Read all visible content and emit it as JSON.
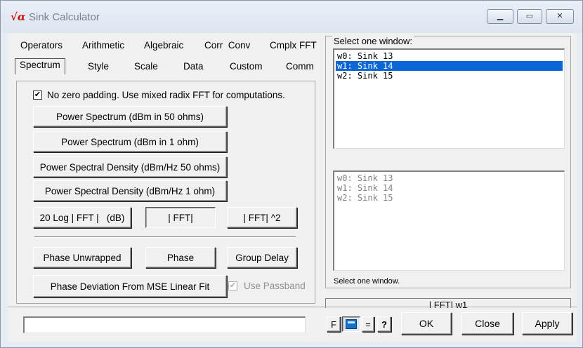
{
  "window": {
    "title": "Sink Calculator",
    "icon": "sqrt-alpha"
  },
  "tabs_row1": [
    {
      "label": "Operators"
    },
    {
      "label": "Arithmetic"
    },
    {
      "label": "Algebraic"
    },
    {
      "label": "Corr  Conv"
    },
    {
      "label": "Cmplx FFT"
    }
  ],
  "tabs_row2": [
    {
      "label": "Spectrum"
    },
    {
      "label": "Style"
    },
    {
      "label": "Scale"
    },
    {
      "label": "Data"
    },
    {
      "label": "Custom"
    },
    {
      "label": "Comm"
    }
  ],
  "spectrum": {
    "zero_padding_label": "No zero padding. Use mixed radix FFT for computations.",
    "zero_padding_checked": true,
    "buttons": {
      "ps50": "Power Spectrum (dBm in 50 ohms)",
      "ps1": "Power Spectrum (dBm in 1 ohm)",
      "psd50": "Power Spectral Density (dBm/Hz 50 ohms)",
      "psd1": "Power Spectral Density (dBm/Hz 1 ohm)",
      "log": "20 Log | FFT |   (dB)",
      "abs": "| FFT|",
      "abs2": "| FFT| ^2",
      "unwrapped": "Phase Unwrapped",
      "phase": "Phase",
      "group": "Group Delay",
      "deviation": "Phase Deviation From MSE Linear Fit"
    },
    "use_passband_label": "Use Passband",
    "use_passband_checked": true
  },
  "right": {
    "select_label": "Select one window:",
    "list1": [
      "w0: Sink 13",
      "w1: Sink 14",
      "w2: Sink 15"
    ],
    "list1_selected": 1,
    "list2": [
      "w0: Sink 13",
      "w1: Sink 14",
      "w2: Sink 15"
    ],
    "status": "Select one window.",
    "expression": "| FFT| w1"
  },
  "bottom": {
    "expr_input": "",
    "f_label": "F",
    "calc_icon": "calculator-icon",
    "eq_label": "=",
    "help_label": "?",
    "ok": "OK",
    "close": "Close",
    "apply": "Apply"
  }
}
